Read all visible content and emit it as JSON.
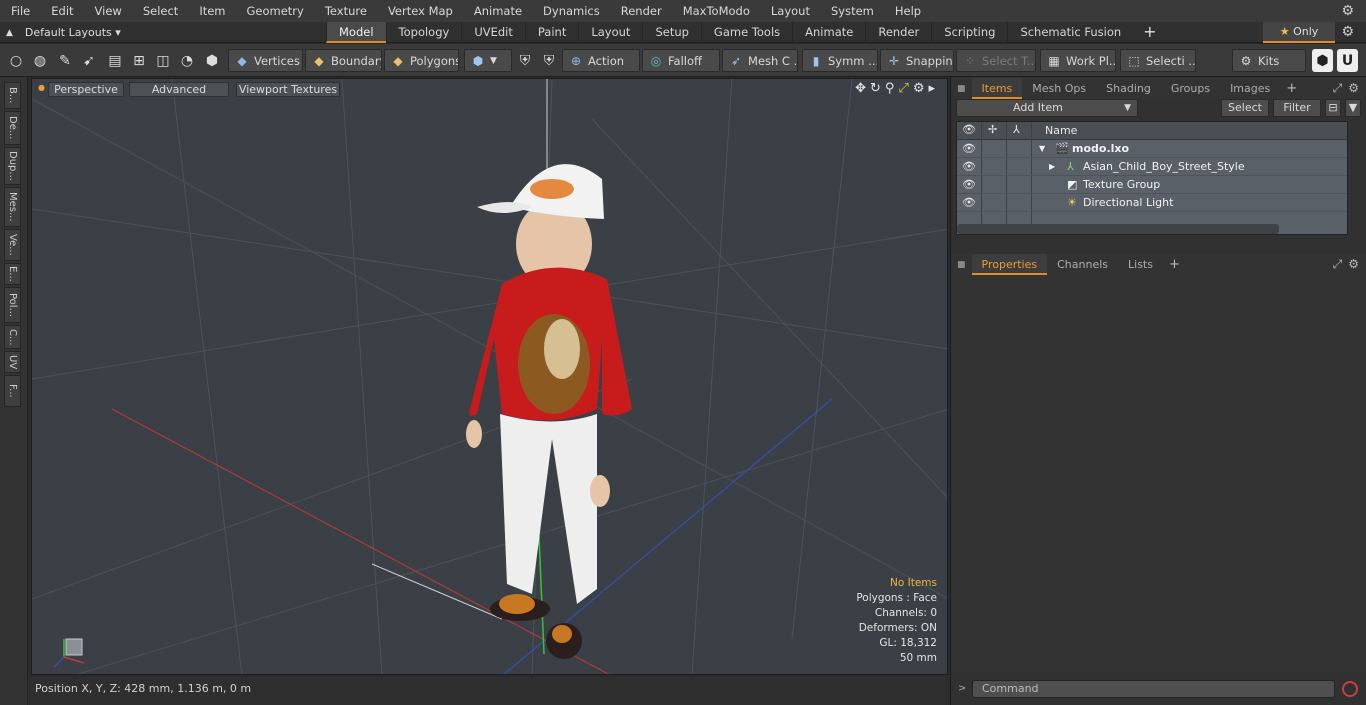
{
  "menu": [
    "File",
    "Edit",
    "View",
    "Select",
    "Item",
    "Geometry",
    "Texture",
    "Vertex Map",
    "Animate",
    "Dynamics",
    "Render",
    "MaxToModo",
    "Layout",
    "System",
    "Help"
  ],
  "layouts": {
    "label": "Default Layouts"
  },
  "tabs": [
    "Model",
    "Topology",
    "UVEdit",
    "Paint",
    "Layout",
    "Setup",
    "Game Tools",
    "Animate",
    "Render",
    "Scripting",
    "Schematic Fusion"
  ],
  "active_tab": "Model",
  "only_label": "Only",
  "toolbar": {
    "vertices": "Vertices",
    "boundary": "Boundary",
    "polygons": "Polygons",
    "action": "Action",
    "falloff": "Falloff",
    "mesh": "Mesh C ...",
    "symm": "Symm ...",
    "snapping": "Snapping",
    "select_t": "Select T...",
    "workplane": "Work Pl...",
    "selecti": "Selecti ...",
    "kits": "Kits"
  },
  "left_tabs": [
    "B...",
    "De...",
    "Dup...",
    "Mes...",
    "Ve...",
    "E...",
    "Pol...",
    "C...",
    "UV",
    "F..."
  ],
  "viewport": {
    "perspective": "Perspective",
    "advanced": "Advanced",
    "textures": "Viewport Textures",
    "hud": {
      "no_items": "No Items",
      "polygons": "Polygons : Face",
      "channels": "Channels: 0",
      "deformers": "Deformers: ON",
      "gl": "GL: 18,312",
      "focal": "50 mm"
    }
  },
  "status": {
    "position": "Position X, Y, Z:   428 mm, 1.136 m, 0 m"
  },
  "items_panel": {
    "tabs": [
      "Items",
      "Mesh Ops",
      "Shading",
      "Groups",
      "Images"
    ],
    "active": "Items",
    "add_item": "Add Item",
    "select": "Select",
    "filter": "Filter",
    "column_name": "Name",
    "scene": "modo.lxo",
    "rows": [
      "Asian_Child_Boy_Street_Style",
      "Texture Group",
      "Directional Light"
    ]
  },
  "properties_panel": {
    "tabs": [
      "Properties",
      "Channels",
      "Lists"
    ],
    "active": "Properties"
  },
  "command": {
    "placeholder": "Command"
  },
  "colors": {
    "accent": "#e08a2c",
    "hud_highlight": "#f4b340",
    "viewport_bg": "#3a4046"
  }
}
